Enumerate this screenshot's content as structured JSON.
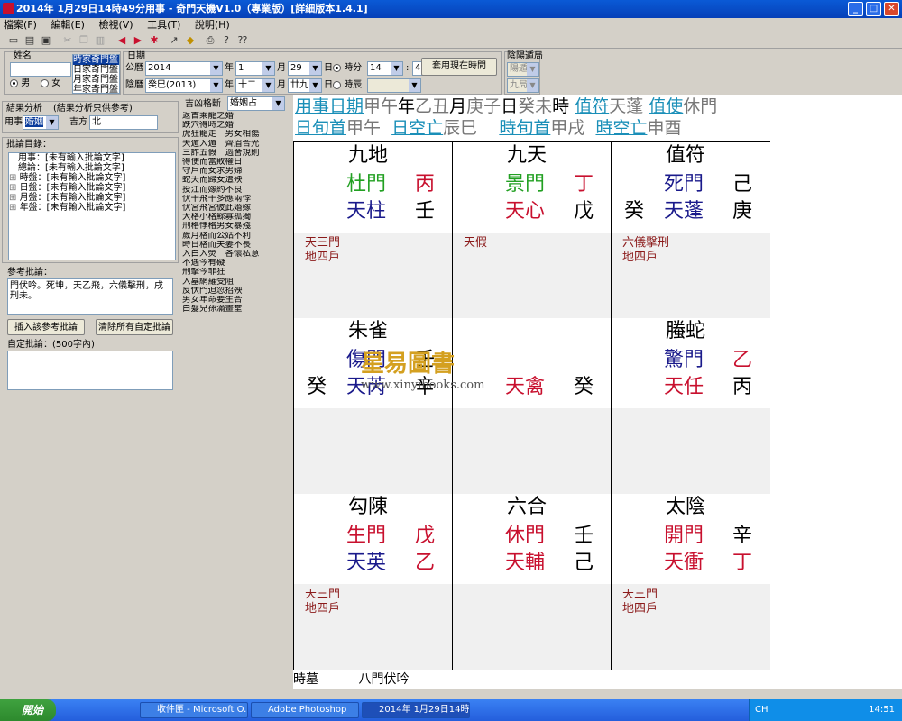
{
  "window": {
    "title": "2014年 1月29日14時49分用事 - 奇門天機V1.0（專業版）[詳細版本1.4.1]",
    "min": "_",
    "max": "□",
    "close": "✕"
  },
  "menu": [
    "檔案(F)",
    "編輯(E)",
    "檢視(V)",
    "工具(T)",
    "說明(H)"
  ],
  "toolbar_icons": [
    "new-icon",
    "open-icon",
    "save-icon",
    "cut-icon",
    "copy-icon",
    "paste-icon",
    "back-icon",
    "forward-icon",
    "star-icon",
    "arrow-icon",
    "erase-icon",
    "print-icon",
    "help-icon",
    "whatsthis-icon"
  ],
  "form": {
    "name_label": "姓名",
    "name_value": "",
    "gender_male": "男",
    "gender_female": "女",
    "pan_list": [
      "時家奇門盤",
      "日家奇門盤",
      "月家奇門盤",
      "年家奇門盤"
    ],
    "date_label": "日期",
    "calendar_solar": "公曆",
    "calendar_lunar": "陰曆",
    "year": "2014",
    "month": "1",
    "day": "29",
    "hour": "14",
    "minute": "49",
    "year_unit": "年",
    "month_unit": "月",
    "day_unit": "日",
    "minute_sep": ":",
    "time_radio": "時分",
    "shichen_radio": "時辰",
    "lunar_year": "癸巳(2013)",
    "lunar_month": "十二",
    "lunar_day": "廿九",
    "use_now_button": "套用現在時間",
    "yinyang_label": "陰陽遁局",
    "yinyang_value": "陽遁",
    "ju_value": "九局"
  },
  "analysis": {
    "title": "結果分析",
    "hint": "(結果分析只供參考)",
    "yongshi_label": "用事",
    "yongshi_value": "婚姻",
    "jifang_label": "吉方",
    "jifang_value": "北"
  },
  "judgment": {
    "title": "批論目錄：",
    "items": [
      "用事：[未有輸入批論文字]",
      "總論：[未有輸入批論文字]",
      "時盤：[未有輸入批論文字]",
      "日盤：[未有輸入批論文字]",
      "月盤：[未有輸入批論文字]",
      "年盤：[未有輸入批論文字]"
    ],
    "ref_title": "參考批論：",
    "ref_text": "門伏吟。死坤，天乙飛，六儀擊刑，戌刑未。",
    "insert_button": "插入該參考批論",
    "clear_button": "清除所有自定批論",
    "custom_title": "自定批論：(500字內)"
  },
  "jixiong": {
    "label": "吉凶格斷",
    "select": "婚姻占",
    "items": [
      "返首乘龍之婚",
      "跌穴得時之婚",
      "虎狂龍走　男女相傷",
      "天遁入遁　齊眉合光",
      "三詐五假　過舍規則",
      "得使而當敗權日",
      "守戶而女求男婦",
      "蛇夭而歸女遭殃",
      "投江而嫁約不良",
      "伏干飛干多應兩悖",
      "伏宮飛宮彼此婚嫁",
      "大格小格鰥寡孤獨",
      "刑格悖格男女暴殘",
      "歲月格而公姑不利",
      "時日格而夫妻不長",
      "入白入熒　各懷私意",
      "不遇今有礙",
      "刑擊今非狂",
      "入墓網羅受阻",
      "反伏門迫忽招殃",
      "男女年命要生合",
      "白髮兒孫滿畫堂"
    ]
  },
  "chart": {
    "hdr1": [
      "用事日期",
      "甲午",
      "年",
      "乙丑",
      "月",
      "庚子",
      "日",
      "癸未",
      "時",
      "值符",
      "天蓬",
      "值使",
      "休門"
    ],
    "hdr2": [
      "日旬首",
      "甲午",
      "日空亡",
      "辰巳",
      "時旬首",
      "甲戌",
      "時空亡",
      "申酉"
    ],
    "cells": [
      {
        "god": "九地",
        "door": "杜門",
        "door_stem": "丙",
        "left_stem": "",
        "star": "天柱",
        "star_stem": "壬",
        "notes": [
          "天三門",
          "地四戶"
        ]
      },
      {
        "god": "九天",
        "door": "景門",
        "door_stem": "丁",
        "left_stem": "",
        "star": "天心",
        "star_stem": "戊",
        "notes": [
          "天假"
        ]
      },
      {
        "god": "值符",
        "door": "死門",
        "door_stem": "己",
        "left_stem": "癸",
        "star": "天蓬",
        "star_stem": "庚",
        "notes": [
          "六儀擊刑",
          "地四戶"
        ]
      },
      {
        "god": "朱雀",
        "door": "傷門",
        "door_stem": "壬",
        "left_stem": "癸",
        "star": "天芮",
        "star_stem": "辛",
        "notes": []
      },
      {
        "god": "",
        "door": "",
        "door_stem": "",
        "left_stem": "",
        "star": "天禽",
        "star_stem": "癸",
        "notes": []
      },
      {
        "god": "螣蛇",
        "door": "驚門",
        "door_stem": "乙",
        "left_stem": "",
        "star": "天任",
        "star_stem": "丙",
        "notes": []
      },
      {
        "god": "勾陳",
        "door": "生門",
        "door_stem": "戊",
        "left_stem": "",
        "star": "天英",
        "star_stem": "乙",
        "notes": [
          "天三門",
          "地四戶"
        ]
      },
      {
        "god": "六合",
        "door": "休門",
        "door_stem": "壬",
        "left_stem": "",
        "star": "天輔",
        "star_stem": "己",
        "notes": []
      },
      {
        "god": "太陰",
        "door": "開門",
        "door_stem": "辛",
        "left_stem": "",
        "star": "天衝",
        "star_stem": "丁",
        "notes": [
          "天三門",
          "地四戶"
        ]
      }
    ],
    "footer": [
      "時墓",
      "八門伏吟"
    ],
    "watermark": {
      "text": "星易圖書",
      "url": "www.xinyibooks.com"
    }
  },
  "taskbar": {
    "start": "開始",
    "tasks": [
      "收件匣 - Microsoft O...",
      "Adobe Photoshop",
      "2014年 1月29日14時..."
    ],
    "lang": "CH",
    "clock": "14:51"
  },
  "colors": {
    "title_blue": "#0a5ad6",
    "red": "#c8102e",
    "blue": "#1a1a8b",
    "green": "#22a022",
    "link": "#1a8fb8"
  }
}
